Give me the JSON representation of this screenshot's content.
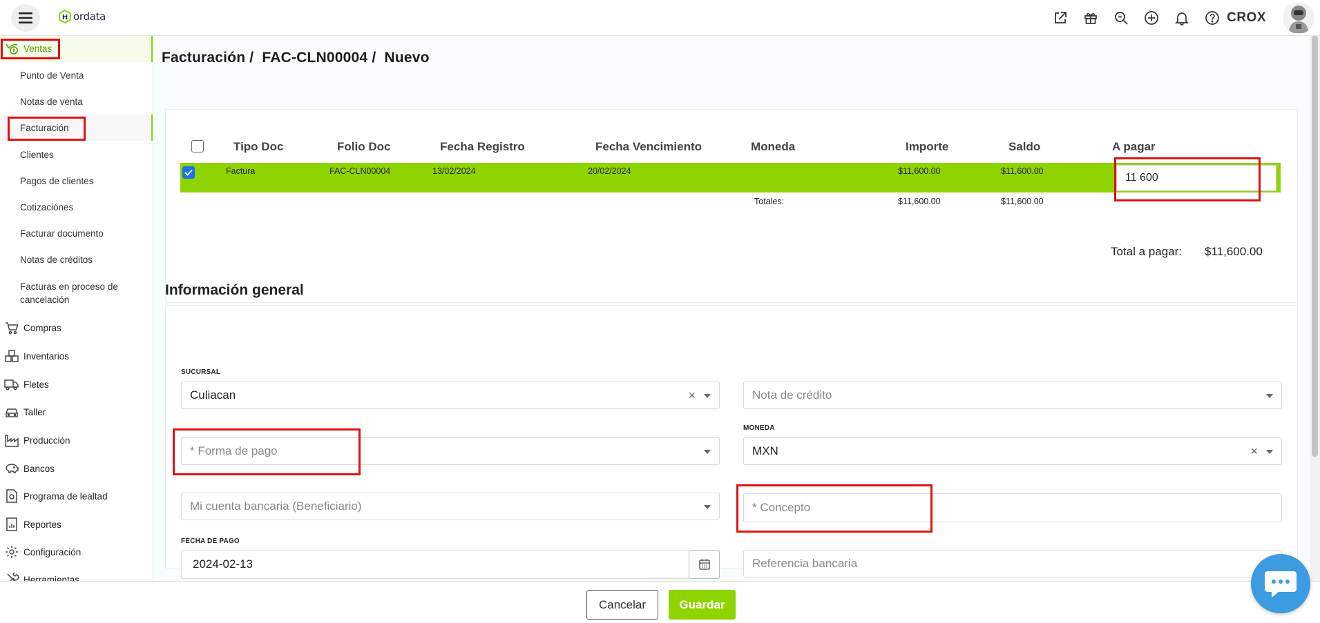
{
  "app": {
    "logo_text": "ordata",
    "user_name": "CROX"
  },
  "icons": {
    "menu": "hamburger-icon",
    "logo": "hordata-logo-icon",
    "external": "external-link-icon",
    "gift": "gift-icon",
    "search": "zoom-search-icon",
    "add": "plus-circle-icon",
    "bell": "bell-icon",
    "help": "help-circle-icon",
    "chat": "chat-icon",
    "calendar": "calendar-icon"
  },
  "colors": {
    "accent": "#8fd400",
    "highlight": "#e01010",
    "chat": "#3d9be0"
  },
  "sidebar": {
    "ventas": "Ventas",
    "sub_items": [
      "Punto de Venta",
      "Notas de venta",
      "Facturación",
      "Clientes",
      "Pagos de clientes",
      "Cotizaciónes",
      "Facturar documento",
      "Notas de créditos",
      "Facturas en proceso de cancelación"
    ],
    "sections": [
      "Compras",
      "Inventarios",
      "Fletes",
      "Taller",
      "Producción",
      "Bancos",
      "Programa de lealtad",
      "Reportes",
      "Configuración",
      "Herramientas"
    ]
  },
  "breadcrumb": [
    "Facturación /",
    "FAC-CLN00004 /",
    "Nuevo"
  ],
  "table": {
    "headers": [
      "Tipo Doc",
      "Folio Doc",
      "Fecha Registro",
      "Fecha Vencimiento",
      "Moneda",
      "Importe",
      "Saldo",
      "A pagar"
    ],
    "row": {
      "checked": true,
      "tipo": "Factura",
      "folio": "FAC-CLN00004",
      "fecha_registro": "13/02/2024",
      "fecha_vencimiento": "20/02/2024",
      "moneda": "",
      "importe": "$11,600.00",
      "saldo": "$11,600.00",
      "a_pagar": "11 600"
    },
    "totales_label": "Totales:",
    "totales_importe": "$11,600.00",
    "totales_saldo": "$11,600.00",
    "total_pagar_label": "Total a pagar:",
    "total_pagar_value": "$11,600.00"
  },
  "info": {
    "title": "Información general",
    "sucursal_label": "SUCURSAL",
    "sucursal_value": "Culiacan",
    "nota_credito_placeholder": "Nota de crédito",
    "forma_pago_placeholder": "* Forma de pago",
    "moneda_label": "MONEDA",
    "moneda_value": "MXN",
    "cuenta_placeholder": "Mi cuenta bancaria (Beneficiario)",
    "concepto_placeholder": "* Concepto",
    "fecha_pago_label": "FECHA DE PAGO",
    "fecha_pago_value": "2024-02-13",
    "referencia_placeholder": "Referencia bancaria"
  },
  "footer": {
    "cancel": "Cancelar",
    "save": "Guardar"
  }
}
